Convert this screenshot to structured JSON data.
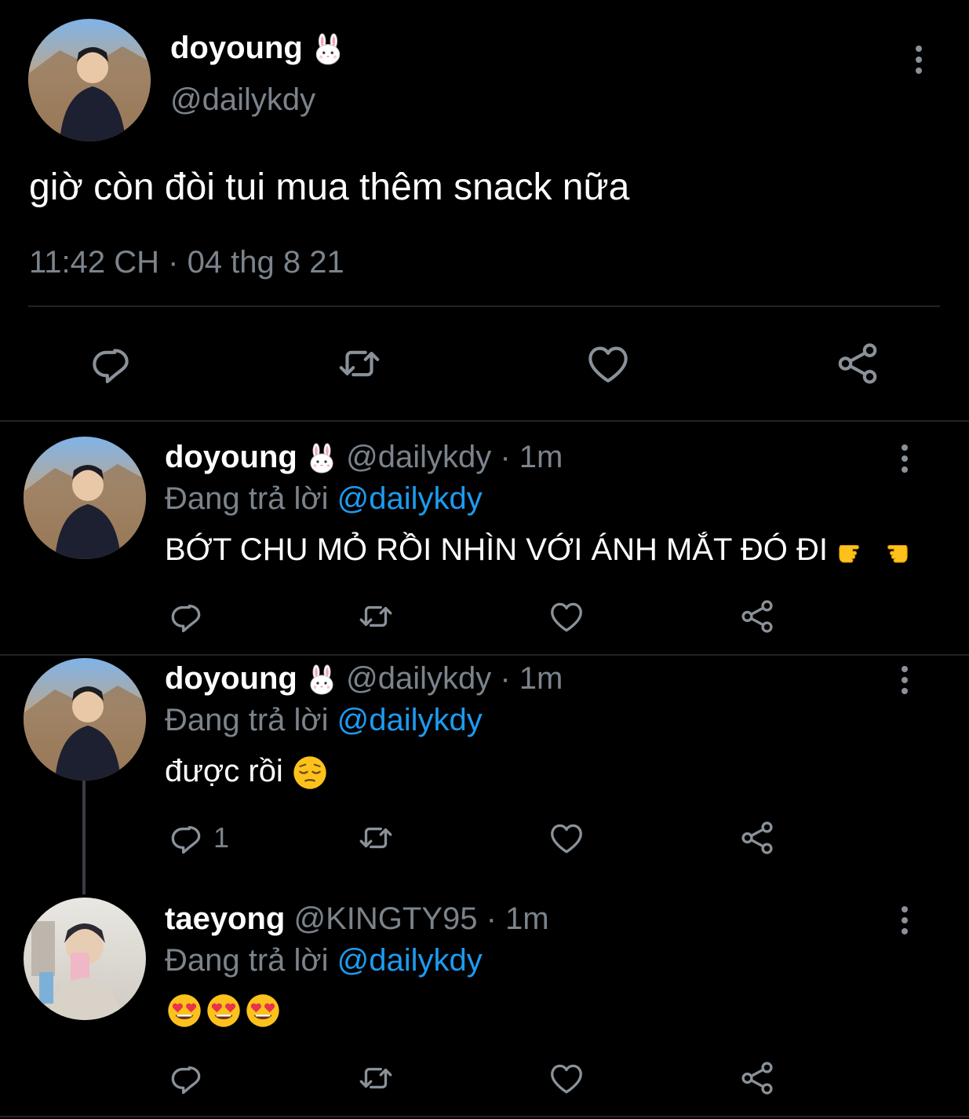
{
  "main_tweet": {
    "display_name": "doyoung",
    "handle": "@dailykdy",
    "text": "giờ còn đòi tui mua thêm snack nữa",
    "timestamp": "11:42 CH · 04 thg 8 21"
  },
  "replies": [
    {
      "display_name": "doyoung",
      "handle": "@dailykdy",
      "time": "· 1m",
      "replying_prefix": "Đang trả lời",
      "replying_to": "@dailykdy",
      "text": "BỚT CHU MỎ RỒI NHÌN VỚI ÁNH MẮT ĐÓ ĐI",
      "reply_count": ""
    },
    {
      "display_name": "doyoung",
      "handle": "@dailykdy",
      "time": "· 1m",
      "replying_prefix": "Đang trả lời",
      "replying_to": "@dailykdy",
      "text": "được rồi",
      "reply_count": "1"
    },
    {
      "display_name": "taeyong",
      "handle": "@KINGTY95",
      "time": "· 1m",
      "replying_prefix": "Đang trả lời",
      "replying_to": "@dailykdy",
      "text": "",
      "reply_count": ""
    }
  ],
  "icons": {
    "reply": "speech-bubble-icon",
    "retweet": "retweet-icon",
    "like": "heart-icon",
    "share": "share-icon",
    "more": "more-vertical-icon",
    "rabbit": "rabbit-face-emoji",
    "pointing": "pointing-hands-emoji",
    "pensive": "pensive-face-emoji",
    "heart_eyes": "heart-eyes-emoji"
  },
  "colors": {
    "background": "#000000",
    "link": "#1d9bf0",
    "muted": "#7b838b",
    "text": "#e7e9ea"
  }
}
